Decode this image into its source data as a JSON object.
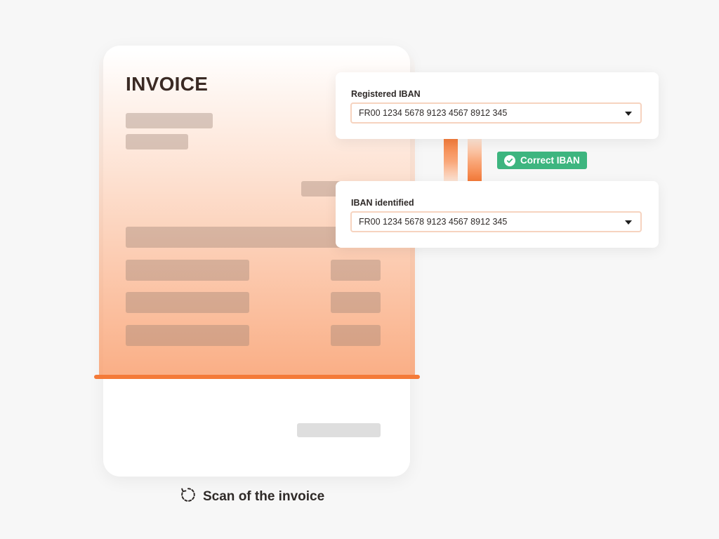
{
  "invoice": {
    "title": "INVOICE"
  },
  "registered_iban": {
    "label": "Registered IBAN",
    "value": "FR00 1234 5678 9123 4567 8912 345"
  },
  "identified_iban": {
    "label": "IBAN identified",
    "value": "FR00 1234 5678 9123 4567 8912 345"
  },
  "status_badge": {
    "label": "Correct IBAN",
    "icon": "check-circle-icon",
    "color": "#3db57f"
  },
  "caption": {
    "text": "Scan of the invoice",
    "icon": "rotate-icon"
  },
  "colors": {
    "accent": "#f47a38",
    "background": "#f7f7f7"
  }
}
